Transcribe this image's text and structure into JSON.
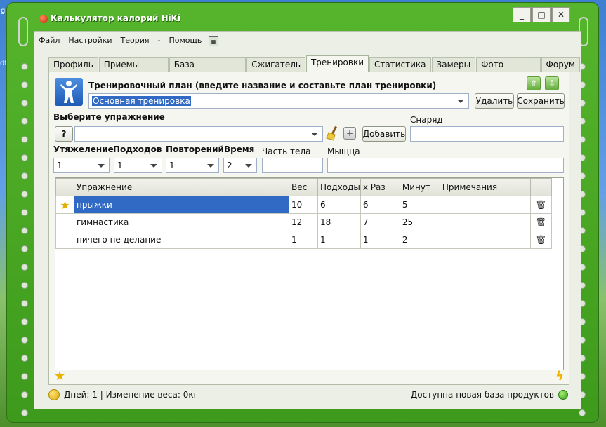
{
  "app": {
    "title": "Калькулятор калорий HiKi"
  },
  "window_buttons": {
    "minimize": "_",
    "maximize": "□",
    "close": "✕"
  },
  "menu": {
    "items": [
      "Файл",
      "Настройки",
      "Теория",
      "-",
      "Помощь"
    ]
  },
  "tabs": [
    "Профиль",
    "Приемы пищи",
    "База продуктов",
    "Сжигатель",
    "Тренировки",
    "Статистика",
    "Замеры",
    "Фото отчеты",
    "Форум"
  ],
  "active_tab": "Тренировки",
  "plan": {
    "label": "Тренировочный план (введите название и составьте план тренировки)",
    "value": "Основная тренировка",
    "delete_label": "Удалить",
    "save_label": "Сохранить"
  },
  "exercise": {
    "label": "Выберите упражнение",
    "help_label": "?",
    "value": "",
    "add_label": "Добавить",
    "equipment_label": "Снаряд",
    "equipment_value": ""
  },
  "params": {
    "weight_label": "Утяжеление",
    "weight_value": "1",
    "sets_label": "Подходов",
    "sets_value": "1",
    "reps_label": "Повторений",
    "reps_value": "1",
    "time_label": "Время",
    "time_value": "2",
    "body_part_label": "Часть тела",
    "body_part_value": "",
    "muscle_label": "Мыщца",
    "muscle_value": ""
  },
  "table": {
    "columns": [
      "Упражнение",
      "Вес",
      "Подходы",
      "x Раз",
      "Минут",
      "Примечания"
    ],
    "rows": [
      [
        "прыжки",
        "10",
        "6",
        "6",
        "5",
        ""
      ],
      [
        "гимнастика",
        "12",
        "18",
        "7",
        "25",
        ""
      ],
      [
        "ничего не делание",
        "1",
        "1",
        "1",
        "2",
        ""
      ]
    ]
  },
  "status": {
    "left": "Дней: 1 | Изменение веса: 0кг",
    "right": "Доступна новая база продуктов"
  },
  "desktop": {
    "frag1": "g",
    "frag2": "df"
  },
  "colors": {
    "window": "#3d9a1c",
    "selection": "#316ac5",
    "panel": "#f5f6f0"
  }
}
